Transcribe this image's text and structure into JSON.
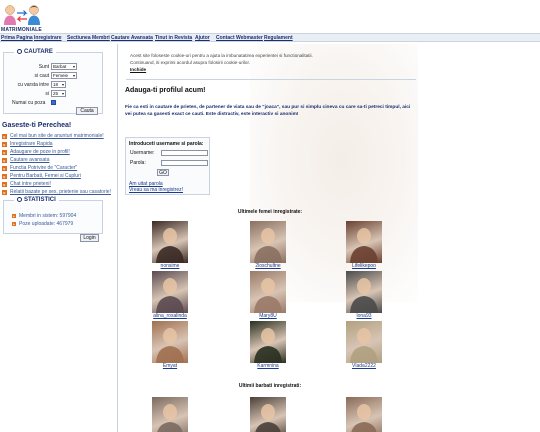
{
  "logo": {
    "text": "MATRIMONIALE"
  },
  "nav": [
    "Prima Pagina",
    "Inregistrare",
    "Sectiunea Membri",
    "Cautare Avansata",
    "Tinut in Revista",
    "Ajutor",
    "Contact Webmaster",
    "Regulament"
  ],
  "search": {
    "title": "CAUTARE",
    "sunt_label": "Sunt",
    "sunt_value": "Barbat",
    "caut_label": "si caut",
    "caut_value": "Femeie",
    "varsta_label": "cu varsta intre",
    "varsta_min": "18",
    "si_label": "si",
    "varsta_max": "25",
    "poza_label": "Numai cu poza",
    "button": "Cauta"
  },
  "promo": {
    "title": "Gaseste-ti Perechea!",
    "links": [
      "Cel mai bun site de anunturi matrimoniale!",
      "Inregistrare Rapida",
      "Adaugare de poze in profil!",
      "Cautare avansata",
      "Functia Potrivire de \"Caracter\"",
      "Pentru Barbati, Femei si Cupluri",
      "Chat intre prieteni!",
      "Relatii bazate pe sex, prietenie sau casatorie!"
    ]
  },
  "stats": {
    "title": "STATISTICI",
    "items": [
      "Membri in sistem: 597904",
      "Poze uploadate: 467979"
    ],
    "login_button": "Login"
  },
  "cookie": {
    "line1": "Acest site foloseste cookie-uri pentru a ajuta la imbunatatirea experientei si functionalitatii.",
    "line2": "Continuand, iti exprimi acordul asupra folosirii cookie-urilor.",
    "link": "Inchide"
  },
  "main": {
    "heading": "Adauga-ti profilul acum!",
    "intro": "Fie ca esti in cautare de prieten, de partener de viata sau de \"joaca\", sau pur si simplu cineva cu care sa-ti petreci timpul, aici vei putea sa gasesti exact ce cauti. Este distractiv, este interactiv si anonim!"
  },
  "login": {
    "heading": "Introduceti username si parola:",
    "username_label": "Username:",
    "password_label": "Parola:",
    "go_button": "GO",
    "forgot": "Am uitat parola",
    "register": "Vreau sa ma inregistrez!"
  },
  "women": {
    "title": "Ultimele femei inregistrate:",
    "items": [
      {
        "name": "nonsime",
        "color": "#3a2a24"
      },
      {
        "name": "2loschultne",
        "color": "#8a7060"
      },
      {
        "name": "Lifelikepoo",
        "color": "#6a4030"
      },
      {
        "name": "alina_rosalinda",
        "color": "#5a4a50"
      },
      {
        "name": "Mary8U",
        "color": "#9a7a68"
      },
      {
        "name": "lona93",
        "color": "#4a4a4a"
      },
      {
        "name": "Emyat",
        "color": "#a07050"
      },
      {
        "name": "Karmnina",
        "color": "#2a3020"
      },
      {
        "name": "Vlada2222",
        "color": "#b0a080"
      }
    ]
  },
  "men": {
    "title": "Ultimii barbati inregistrati:",
    "items": [
      {
        "name": "",
        "color": "#7a6a60"
      },
      {
        "name": "",
        "color": "#4a4038"
      },
      {
        "name": "",
        "color": "#8a6a58"
      }
    ]
  }
}
